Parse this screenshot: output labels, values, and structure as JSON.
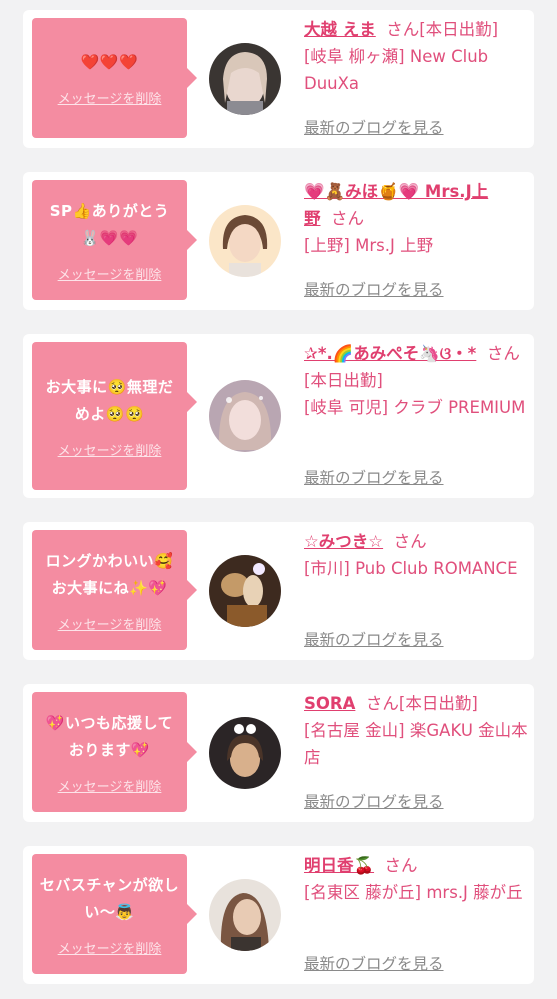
{
  "cards": [
    {
      "message": "❤️❤️❤️",
      "delete_label": "メッセージを削除",
      "name": "大越 えま",
      "suffix": "さん",
      "status": "[本日出勤]",
      "shop": "[岐阜 柳ヶ瀬] New Club DuuXa",
      "blog_label": "最新のブログを見る"
    },
    {
      "message": "SP👍ありがとう 🐰💗💗",
      "delete_label": "メッセージを削除",
      "name": "💗🧸みほ🍯💗 Mrs.J上野",
      "suffix": "さん",
      "status": "",
      "shop": "[上野] Mrs.J 上野",
      "blog_label": "最新のブログを見る"
    },
    {
      "message": "お大事に🥺無理だめよ🥺🥺",
      "delete_label": "メッセージを削除",
      "name": "✰*.🌈あみぺそ🦄ଓ・*",
      "suffix": "さん",
      "status": "[本日出勤]",
      "shop": "[岐阜 可児] クラブ PREMIUM",
      "blog_label": "最新のブログを見る"
    },
    {
      "message": "ロングかわいい🥰 お大事にね✨💖",
      "delete_label": "メッセージを削除",
      "name": "☆みつき☆",
      "suffix": "さん",
      "status": "",
      "shop": "[市川] Pub Club ROMANCE",
      "blog_label": "最新のブログを見る"
    },
    {
      "message": "💖いつも応援して おります💖",
      "delete_label": "メッセージを削除",
      "name": "SORA",
      "suffix": "さん",
      "status": "[本日出勤]",
      "shop": "[名古屋 金山] 楽GAKU 金山本店",
      "blog_label": "最新のブログを見る"
    },
    {
      "message": "セバスチャンが欲しい〜👼",
      "delete_label": "メッセージを削除",
      "name": "明日香🍒",
      "suffix": "さん",
      "status": "",
      "shop": "[名東区 藤が丘] mrs.J 藤が丘",
      "blog_label": "最新のブログを見る"
    }
  ]
}
